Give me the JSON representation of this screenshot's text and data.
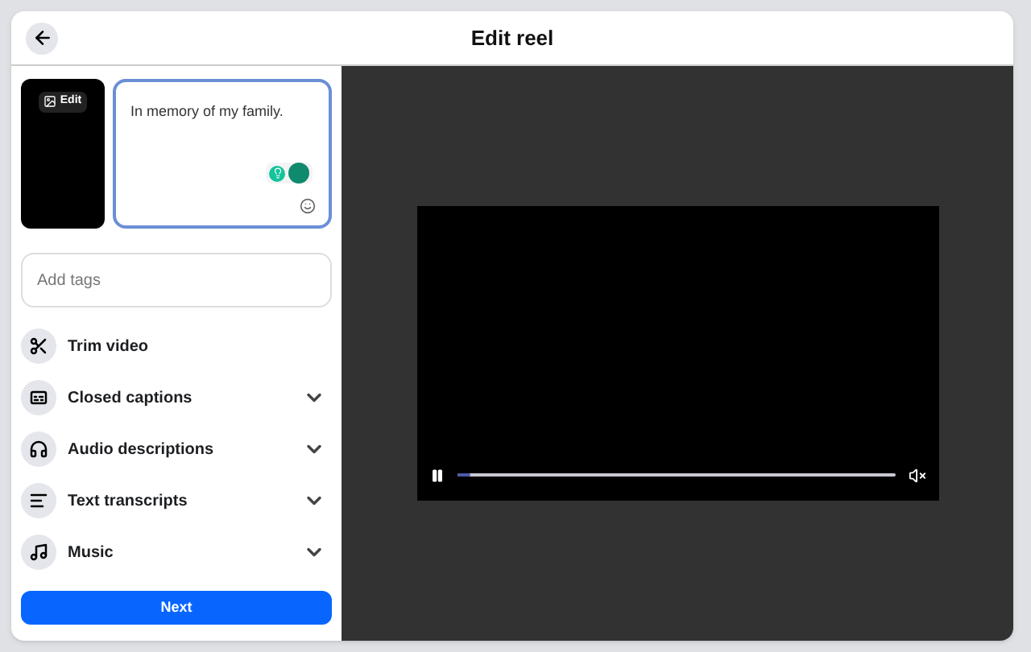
{
  "dialog": {
    "title": "Edit reel"
  },
  "thumbnail": {
    "edit_label": "Edit"
  },
  "caption": {
    "value": "In memory of my family."
  },
  "tags": {
    "placeholder": "Add tags"
  },
  "options": [
    {
      "kind": "scissors",
      "label": "Trim video",
      "expandable": false
    },
    {
      "kind": "captions",
      "label": "Closed captions",
      "expandable": true
    },
    {
      "kind": "headphones",
      "label": "Audio descriptions",
      "expandable": true
    },
    {
      "kind": "transcript",
      "label": "Text transcripts",
      "expandable": true
    },
    {
      "kind": "music",
      "label": "Music",
      "expandable": true
    }
  ],
  "next_button": "Next",
  "player": {
    "playing": true,
    "level": 0.03,
    "muted": true
  }
}
